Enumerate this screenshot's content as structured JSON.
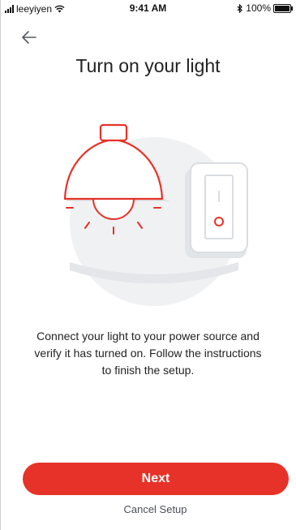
{
  "status_bar": {
    "carrier": "leeyiyen",
    "time": "9:41 AM",
    "battery": "100%"
  },
  "header": {
    "back_icon": "arrow-left-icon"
  },
  "main": {
    "title": "Turn on your light",
    "illustration_icon": "lamp-and-light-switch-illustration",
    "description": "Connect your light to your power source and verify it has turned on. Follow the instructions to finish the setup."
  },
  "footer": {
    "next_label": "Next",
    "cancel_label": "Cancel Setup"
  },
  "colors": {
    "accent": "#e63228",
    "switch_light": "#d9dde2",
    "circle_bg": "#f0f1f3",
    "text_primary": "#222222",
    "text_secondary": "#4a4f57"
  }
}
